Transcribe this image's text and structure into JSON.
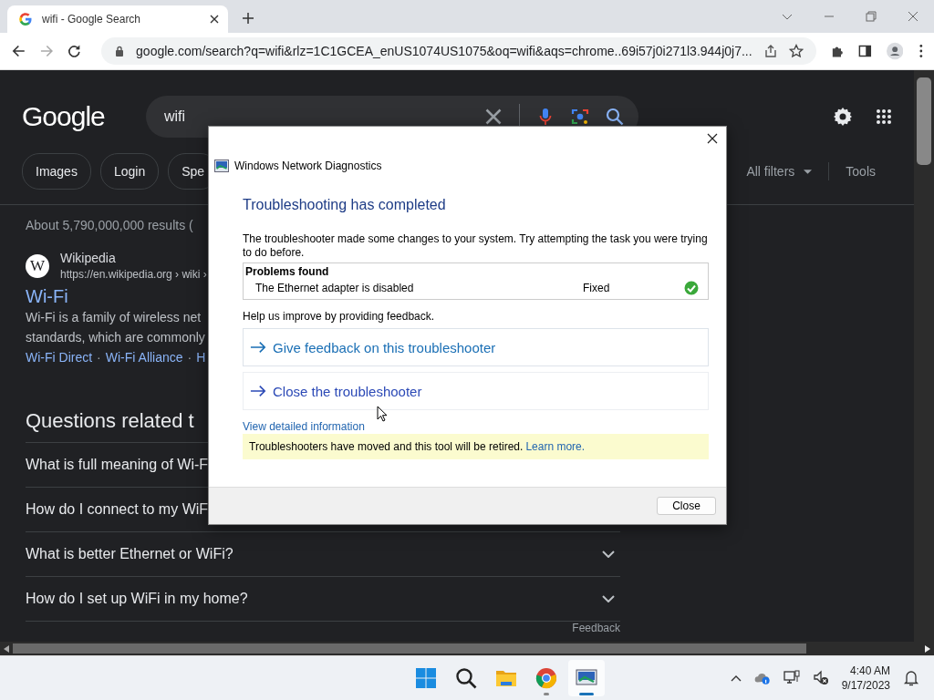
{
  "browser": {
    "tab_title": "wifi - Google Search",
    "url": "google.com/search?q=wifi&rlz=1C1GCEA_enUS1074US1075&oq=wifi&aqs=chrome..69i57j0i271l3.944j0j7..."
  },
  "google": {
    "logo": "Google",
    "query": "wifi",
    "chips": [
      "Images",
      "Login",
      "Spe"
    ],
    "all_filters": "All filters",
    "tools": "Tools",
    "results_count": "About 5,790,000,000 results (",
    "result": {
      "favicon": "W",
      "source": "Wikipedia",
      "url": "https://en.wikipedia.org › wiki ›",
      "title": "Wi-Fi",
      "snippet": [
        "Wi-Fi is a family of wireless net",
        "standards, which are commonly"
      ],
      "links": [
        "Wi-Fi Direct",
        "Wi-Fi Alliance",
        "H"
      ],
      "link_separator": "·"
    },
    "questions_heading": "Questions related t",
    "questions": [
      "What is full meaning of Wi-F",
      "How do I connect to my WiF",
      "What is better Ethernet or WiFi?",
      "How do I set up WiFi in my home?"
    ],
    "feedback": "Feedback"
  },
  "dialog": {
    "title": "Windows Network Diagnostics",
    "heading": "Troubleshooting has completed",
    "message": "The troubleshooter made some changes to your system. Try attempting the task you were trying to do before.",
    "problems": {
      "header": "Problems found",
      "rows": [
        {
          "problem": "The Ethernet adapter is disabled",
          "status": "Fixed",
          "fixed": true
        }
      ]
    },
    "feedback_prompt": "Help us improve by providing feedback.",
    "actions": [
      {
        "label": "Give feedback on this troubleshooter",
        "selected": false
      },
      {
        "label": "Close the troubleshooter",
        "selected": true
      }
    ],
    "details_link": "View detailed information",
    "notice": {
      "text": "Troubleshooters have moved and this tool will be retired.",
      "link": "Learn more."
    },
    "button": "Close"
  },
  "taskbar": {
    "apps": [
      {
        "kind": "start",
        "running": false,
        "selected": false
      },
      {
        "kind": "search",
        "running": false,
        "selected": false
      },
      {
        "kind": "explorer",
        "running": false,
        "selected": false
      },
      {
        "kind": "browser",
        "running": true,
        "selected": false
      },
      {
        "kind": "diagnostics",
        "running": true,
        "selected": true
      }
    ],
    "time": "4:40 AM",
    "date": "9/17/2023"
  }
}
